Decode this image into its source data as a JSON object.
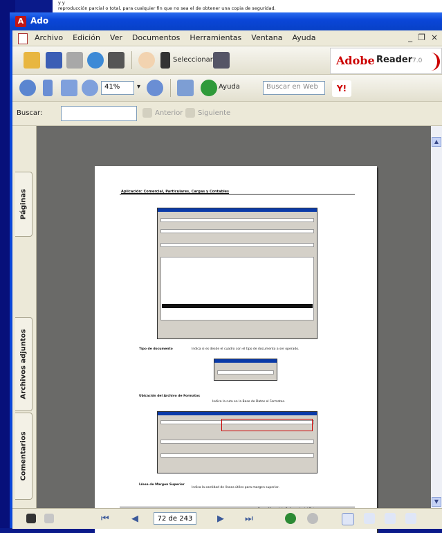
{
  "notice": {
    "line1": "                    y                                                                                      y",
    "line2": "reproducción parcial o total, para cualquier fin que no sea el de obtener una copia de seguridad."
  },
  "window": {
    "title": "Ado"
  },
  "menu": {
    "items": [
      "Archivo",
      "Edición",
      "Ver",
      "Documentos",
      "Herramientas",
      "Ventana",
      "Ayuda"
    ],
    "controls": [
      "_",
      "×"
    ]
  },
  "toolbar": {
    "select_label": "Seleccionar",
    "zoom_value": "41%",
    "help_label": "Ayuda",
    "web_search_placeholder": "Buscar en Web",
    "brand": {
      "name": "Adobe",
      "product": "Reader",
      "version": "7.0"
    }
  },
  "findbar": {
    "label": "Buscar:",
    "value": "",
    "prev_label": "Anterior",
    "next_label": "Siguiente"
  },
  "side_tabs": {
    "pages": "Páginas",
    "attachments": "Archivos adjuntos",
    "comments": "Comentarios"
  },
  "document": {
    "heading": "Aplicación: Comercial, Particulares, Cargas y Contables",
    "labels": [
      "Tipo de documento",
      "Ubicación del Archivo de Formatos",
      "Línea de Margen Superior"
    ],
    "texts": [
      "Indica si es desde el cuadro con el tipo de documento a ser operado.",
      "Indica la ruta en la Base de Datos el Formatos.",
      "Indica la cantidad de líneas útiles para margen superior."
    ],
    "footer": "Paso  -  Manual de Referencia del Sistema"
  },
  "status": {
    "page_display": "72 de 243"
  },
  "colors": {
    "titlebar": "#0a46d8",
    "brand_red": "#cc0000",
    "doc_bg": "#6a6a68"
  }
}
